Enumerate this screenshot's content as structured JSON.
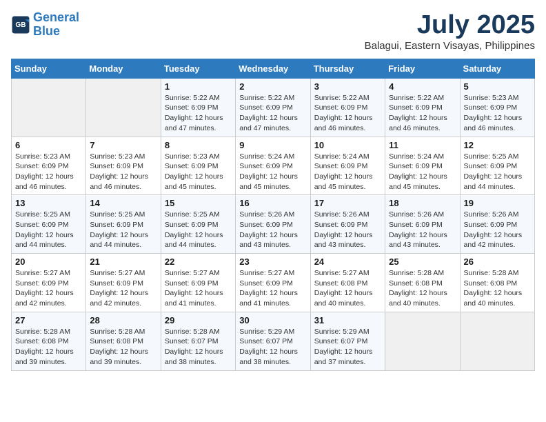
{
  "header": {
    "logo_line1": "General",
    "logo_line2": "Blue",
    "title": "July 2025",
    "subtitle": "Balagui, Eastern Visayas, Philippines"
  },
  "weekdays": [
    "Sunday",
    "Monday",
    "Tuesday",
    "Wednesday",
    "Thursday",
    "Friday",
    "Saturday"
  ],
  "weeks": [
    [
      {
        "day": "",
        "info": ""
      },
      {
        "day": "",
        "info": ""
      },
      {
        "day": "1",
        "info": "Sunrise: 5:22 AM\nSunset: 6:09 PM\nDaylight: 12 hours and 47 minutes."
      },
      {
        "day": "2",
        "info": "Sunrise: 5:22 AM\nSunset: 6:09 PM\nDaylight: 12 hours and 47 minutes."
      },
      {
        "day": "3",
        "info": "Sunrise: 5:22 AM\nSunset: 6:09 PM\nDaylight: 12 hours and 46 minutes."
      },
      {
        "day": "4",
        "info": "Sunrise: 5:22 AM\nSunset: 6:09 PM\nDaylight: 12 hours and 46 minutes."
      },
      {
        "day": "5",
        "info": "Sunrise: 5:23 AM\nSunset: 6:09 PM\nDaylight: 12 hours and 46 minutes."
      }
    ],
    [
      {
        "day": "6",
        "info": "Sunrise: 5:23 AM\nSunset: 6:09 PM\nDaylight: 12 hours and 46 minutes."
      },
      {
        "day": "7",
        "info": "Sunrise: 5:23 AM\nSunset: 6:09 PM\nDaylight: 12 hours and 46 minutes."
      },
      {
        "day": "8",
        "info": "Sunrise: 5:23 AM\nSunset: 6:09 PM\nDaylight: 12 hours and 45 minutes."
      },
      {
        "day": "9",
        "info": "Sunrise: 5:24 AM\nSunset: 6:09 PM\nDaylight: 12 hours and 45 minutes."
      },
      {
        "day": "10",
        "info": "Sunrise: 5:24 AM\nSunset: 6:09 PM\nDaylight: 12 hours and 45 minutes."
      },
      {
        "day": "11",
        "info": "Sunrise: 5:24 AM\nSunset: 6:09 PM\nDaylight: 12 hours and 45 minutes."
      },
      {
        "day": "12",
        "info": "Sunrise: 5:25 AM\nSunset: 6:09 PM\nDaylight: 12 hours and 44 minutes."
      }
    ],
    [
      {
        "day": "13",
        "info": "Sunrise: 5:25 AM\nSunset: 6:09 PM\nDaylight: 12 hours and 44 minutes."
      },
      {
        "day": "14",
        "info": "Sunrise: 5:25 AM\nSunset: 6:09 PM\nDaylight: 12 hours and 44 minutes."
      },
      {
        "day": "15",
        "info": "Sunrise: 5:25 AM\nSunset: 6:09 PM\nDaylight: 12 hours and 44 minutes."
      },
      {
        "day": "16",
        "info": "Sunrise: 5:26 AM\nSunset: 6:09 PM\nDaylight: 12 hours and 43 minutes."
      },
      {
        "day": "17",
        "info": "Sunrise: 5:26 AM\nSunset: 6:09 PM\nDaylight: 12 hours and 43 minutes."
      },
      {
        "day": "18",
        "info": "Sunrise: 5:26 AM\nSunset: 6:09 PM\nDaylight: 12 hours and 43 minutes."
      },
      {
        "day": "19",
        "info": "Sunrise: 5:26 AM\nSunset: 6:09 PM\nDaylight: 12 hours and 42 minutes."
      }
    ],
    [
      {
        "day": "20",
        "info": "Sunrise: 5:27 AM\nSunset: 6:09 PM\nDaylight: 12 hours and 42 minutes."
      },
      {
        "day": "21",
        "info": "Sunrise: 5:27 AM\nSunset: 6:09 PM\nDaylight: 12 hours and 42 minutes."
      },
      {
        "day": "22",
        "info": "Sunrise: 5:27 AM\nSunset: 6:09 PM\nDaylight: 12 hours and 41 minutes."
      },
      {
        "day": "23",
        "info": "Sunrise: 5:27 AM\nSunset: 6:09 PM\nDaylight: 12 hours and 41 minutes."
      },
      {
        "day": "24",
        "info": "Sunrise: 5:27 AM\nSunset: 6:08 PM\nDaylight: 12 hours and 40 minutes."
      },
      {
        "day": "25",
        "info": "Sunrise: 5:28 AM\nSunset: 6:08 PM\nDaylight: 12 hours and 40 minutes."
      },
      {
        "day": "26",
        "info": "Sunrise: 5:28 AM\nSunset: 6:08 PM\nDaylight: 12 hours and 40 minutes."
      }
    ],
    [
      {
        "day": "27",
        "info": "Sunrise: 5:28 AM\nSunset: 6:08 PM\nDaylight: 12 hours and 39 minutes."
      },
      {
        "day": "28",
        "info": "Sunrise: 5:28 AM\nSunset: 6:08 PM\nDaylight: 12 hours and 39 minutes."
      },
      {
        "day": "29",
        "info": "Sunrise: 5:28 AM\nSunset: 6:07 PM\nDaylight: 12 hours and 38 minutes."
      },
      {
        "day": "30",
        "info": "Sunrise: 5:29 AM\nSunset: 6:07 PM\nDaylight: 12 hours and 38 minutes."
      },
      {
        "day": "31",
        "info": "Sunrise: 5:29 AM\nSunset: 6:07 PM\nDaylight: 12 hours and 37 minutes."
      },
      {
        "day": "",
        "info": ""
      },
      {
        "day": "",
        "info": ""
      }
    ]
  ]
}
